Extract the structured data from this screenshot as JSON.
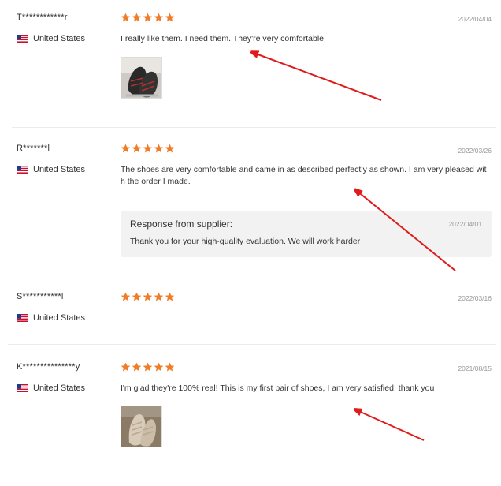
{
  "colors": {
    "star": "#f07c27",
    "arrow": "#e01b1b",
    "date": "#999999",
    "response_bg": "#f2f2f2"
  },
  "reviews": [
    {
      "username": "T************r",
      "country": "United States",
      "rating": 5,
      "date": "2022/04/04",
      "text": "I really like them. I need them. They're very comfortable",
      "has_photo": true
    },
    {
      "username": "R*******l",
      "country": "United States",
      "rating": 5,
      "date": "2022/03/26",
      "text": "The shoes are very comfortable and came in as described perfectly as shown. I am very pleased with the order I made.",
      "has_photo": false,
      "response": {
        "title": "Response from supplier:",
        "date": "2022/04/01",
        "text": "Thank you for your high-quality evaluation. We will work harder"
      }
    },
    {
      "username": "S***********l",
      "country": "United States",
      "rating": 5,
      "date": "2022/03/16",
      "text": "",
      "has_photo": false
    },
    {
      "username": "K***************y",
      "country": "United States",
      "rating": 5,
      "date": "2021/08/15",
      "text": "I'm glad they're 100% real! This is my first pair of shoes, I am very satisfied! thank you",
      "has_photo": true
    }
  ]
}
